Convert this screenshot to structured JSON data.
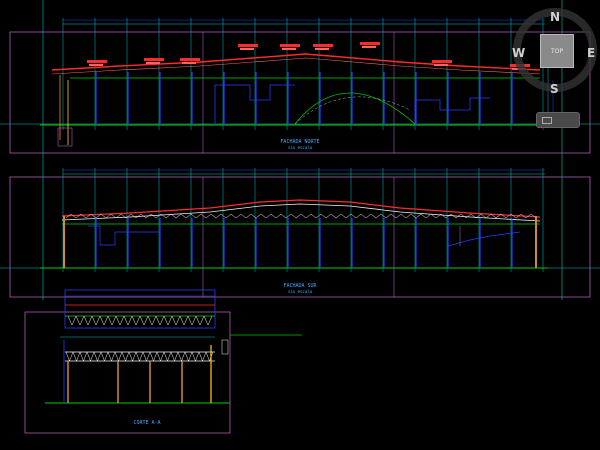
{
  "drawing": {
    "title_elevation_1": "FACHADA NORTE",
    "scale_elevation_1": "sin escala",
    "title_elevation_2": "FACHADA SUR",
    "scale_elevation_2": "sin escala",
    "title_section": "CORTE A-A"
  },
  "viewcube": {
    "face_label": "TOP",
    "north": "N",
    "south": "S",
    "east": "E",
    "west": "W"
  },
  "colors": {
    "background": "#000000",
    "frame": "#b15ab8",
    "grid": "#00c0c0",
    "columns": "#2a3cff",
    "roof": "#ff2a2a",
    "ground": "#00d000",
    "truss": "#f4f4f4",
    "annotation": "#ff3030",
    "wood": "#d08a30"
  }
}
